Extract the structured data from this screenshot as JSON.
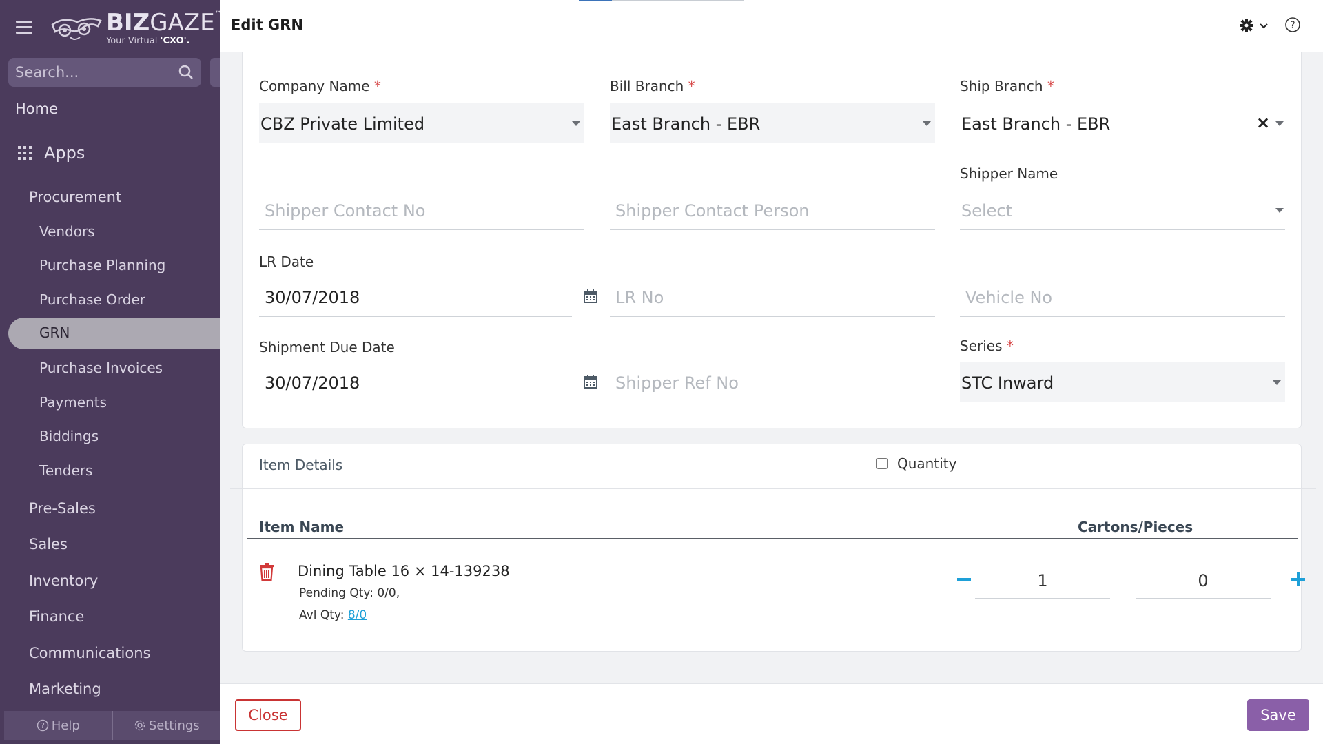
{
  "sidebar": {
    "logo_name_bold": "BIZ",
    "logo_name_light": "GAZE",
    "logo_tm": "™",
    "logo_tag_prefix": "Your Virtual ",
    "logo_tag_bold": "'CXO'.",
    "search_placeholder": "Search...",
    "home": "Home",
    "apps": "Apps",
    "procurement": "Procurement",
    "items": [
      "Vendors",
      "Purchase Planning",
      "Purchase Order",
      "GRN",
      "Purchase Invoices",
      "Payments",
      "Biddings",
      "Tenders"
    ],
    "active_item": "GRN",
    "sections": [
      "Pre-Sales",
      "Sales",
      "Inventory",
      "Finance",
      "Communications",
      "Marketing"
    ],
    "footer_help": "Help",
    "footer_settings": "Settings"
  },
  "header": {
    "title": "Edit GRN"
  },
  "form": {
    "company_name": {
      "label": "Company Name",
      "value": "CBZ Private Limited"
    },
    "bill_branch": {
      "label": "Bill Branch",
      "value": "East Branch - EBR"
    },
    "ship_branch": {
      "label": "Ship Branch",
      "value": "East Branch - EBR",
      "clear": "×"
    },
    "shipper_contact_no": {
      "placeholder": "Shipper Contact No"
    },
    "shipper_contact_person": {
      "placeholder": "Shipper Contact Person"
    },
    "shipper_name": {
      "label": "Shipper Name",
      "placeholder": "Select"
    },
    "lr_date": {
      "label": "LR Date",
      "value": "30/07/2018"
    },
    "lr_no": {
      "placeholder": "LR No"
    },
    "vehicle_no": {
      "placeholder": "Vehicle No"
    },
    "shipment_due_date": {
      "label": "Shipment Due Date",
      "value": "30/07/2018"
    },
    "shipper_ref_no": {
      "placeholder": "Shipper Ref No"
    },
    "series": {
      "label": "Series",
      "value": "STC Inward"
    },
    "required_mark": "*"
  },
  "items": {
    "section_title": "Item Details",
    "quantity_toggle": "Quantity",
    "col_item_name": "Item Name",
    "col_cartons": "Cartons/Pieces",
    "rows": [
      {
        "name": "Dining Table 16 × 14-139238",
        "pending": "Pending Qty: 0/0,",
        "avl_label": "Avl Qty: ",
        "avl_value": "8/0 ",
        "cartons": "1",
        "pieces": "0"
      }
    ]
  },
  "footer": {
    "close": "Close",
    "save": "Save"
  },
  "colors": {
    "sidebar": "#4b3b5c",
    "accent": "#8a5fa8",
    "danger": "#c93434",
    "link": "#1ea0d8"
  }
}
